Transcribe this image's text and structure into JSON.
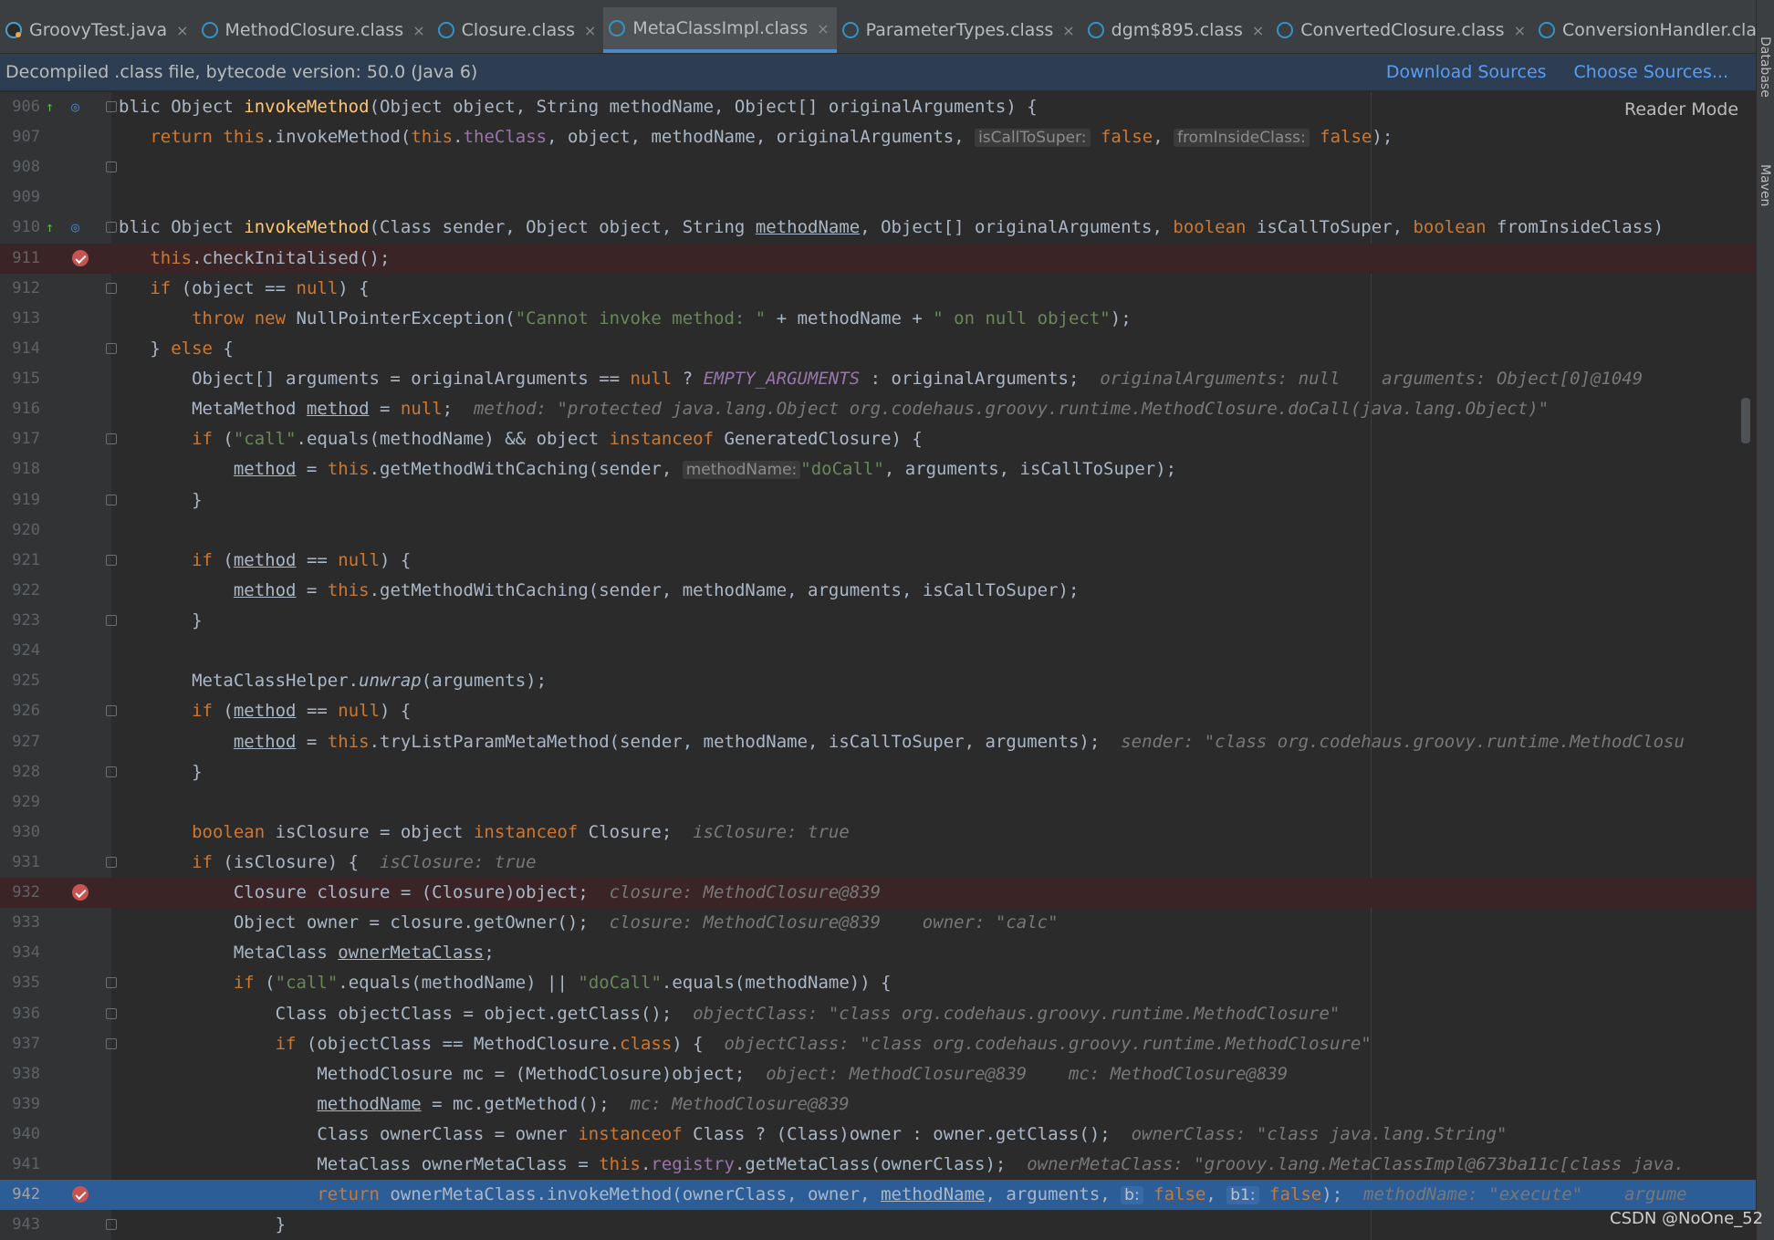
{
  "tabs": [
    {
      "label": "GroovyTest.java",
      "active": false
    },
    {
      "label": "MethodClosure.class",
      "active": false
    },
    {
      "label": "Closure.class",
      "active": false
    },
    {
      "label": "MetaClassImpl.class",
      "active": true
    },
    {
      "label": "ParameterTypes.class",
      "active": false
    },
    {
      "label": "dgm$895.class",
      "active": false
    },
    {
      "label": "ConvertedClosure.class",
      "active": false
    },
    {
      "label": "ConversionHandler.class",
      "active": false
    }
  ],
  "banner": {
    "message": "Decompiled .class file, bytecode version: 50.0 (Java 6)",
    "download": "Download Sources",
    "choose": "Choose Sources..."
  },
  "reader_mode": "Reader Mode",
  "side_tools": [
    "Database",
    "Maven"
  ],
  "watermark": "CSDN @NoOne_52",
  "colors": {
    "accent": "#4a88c7",
    "selected_line": "#2d5d96",
    "breakpoint": "#c75450"
  },
  "lines": [
    {
      "n": "906",
      "gi": [
        "override-icon",
        "quick-doc-icon"
      ],
      "fold": true,
      "segs": [
        [
          "",
          "blic Object "
        ],
        [
          "fn",
          "invokeMethod"
        ],
        [
          "",
          "(Object object, String methodName, Object[] originalArguments) {"
        ]
      ]
    },
    {
      "n": "907",
      "segs": [
        [
          "",
          "   "
        ],
        [
          "kw",
          "return this"
        ],
        [
          "",
          "."
        ],
        [
          "",
          "invokeMethod("
        ],
        [
          "kw",
          "this"
        ],
        [
          "",
          "."
        ],
        [
          "fld",
          "theClass"
        ],
        [
          "",
          ", object, methodName, originalArguments, "
        ],
        [
          "pl",
          "isCallToSuper:"
        ],
        [
          "",
          " "
        ],
        [
          "kw",
          "false"
        ],
        [
          "",
          ", "
        ],
        [
          "pl",
          "fromInsideClass:"
        ],
        [
          "",
          " "
        ],
        [
          "kw",
          "false"
        ],
        [
          "",
          ");"
        ]
      ]
    },
    {
      "n": "908",
      "fold": true,
      "segs": []
    },
    {
      "n": "909",
      "segs": []
    },
    {
      "n": "910",
      "gi": [
        "override-icon",
        "quick-doc-icon"
      ],
      "fold": true,
      "segs": [
        [
          "",
          "blic Object "
        ],
        [
          "fn",
          "invokeMethod"
        ],
        [
          "",
          "(Class sender, Object object, String "
        ],
        [
          "ul",
          "methodName"
        ],
        [
          "",
          ", Object[] originalArguments, "
        ],
        [
          "kw",
          "boolean"
        ],
        [
          "",
          " isCallToSuper, "
        ],
        [
          "kw",
          "boolean"
        ],
        [
          "",
          " fromInsideClass)"
        ]
      ]
    },
    {
      "n": "911",
      "bp": true,
      "segs": [
        [
          "",
          "   "
        ],
        [
          "kw",
          "this"
        ],
        [
          "",
          ".checkInitalised();"
        ]
      ]
    },
    {
      "n": "912",
      "fold": true,
      "segs": [
        [
          "",
          "   "
        ],
        [
          "kw",
          "if"
        ],
        [
          "",
          " (object == "
        ],
        [
          "kw",
          "null"
        ],
        [
          "",
          ") {"
        ]
      ]
    },
    {
      "n": "913",
      "segs": [
        [
          "",
          "       "
        ],
        [
          "kw",
          "throw new"
        ],
        [
          "",
          " NullPointerException("
        ],
        [
          "str",
          "\"Cannot invoke method: \""
        ],
        [
          "",
          " + methodName + "
        ],
        [
          "str",
          "\" on null object\""
        ],
        [
          "",
          ");"
        ]
      ]
    },
    {
      "n": "914",
      "fold": true,
      "segs": [
        [
          "",
          "   } "
        ],
        [
          "kw",
          "else"
        ],
        [
          "",
          " {"
        ]
      ]
    },
    {
      "n": "915",
      "segs": [
        [
          "",
          "       Object[] arguments = originalArguments == "
        ],
        [
          "kw",
          "null"
        ],
        [
          "",
          " ? "
        ],
        [
          "fld ita",
          "EMPTY_ARGUMENTS"
        ],
        [
          "",
          " : originalArguments;  "
        ],
        [
          "hint",
          "originalArguments: null    arguments: Object[0]@1049"
        ]
      ]
    },
    {
      "n": "916",
      "segs": [
        [
          "",
          "       MetaMethod "
        ],
        [
          "ul",
          "method"
        ],
        [
          "",
          " = "
        ],
        [
          "kw",
          "null"
        ],
        [
          "",
          ";  "
        ],
        [
          "hint",
          "method: \"protected java.lang.Object org.codehaus.groovy.runtime.MethodClosure.doCall(java.lang.Object)\""
        ]
      ]
    },
    {
      "n": "917",
      "fold": true,
      "segs": [
        [
          "",
          "       "
        ],
        [
          "kw",
          "if"
        ],
        [
          "",
          " ("
        ],
        [
          "str",
          "\"call\""
        ],
        [
          "",
          ".equals(methodName) && object "
        ],
        [
          "kw",
          "instanceof"
        ],
        [
          "",
          " GeneratedClosure) {"
        ]
      ]
    },
    {
      "n": "918",
      "segs": [
        [
          "",
          "           "
        ],
        [
          "ul",
          "method"
        ],
        [
          "",
          " = "
        ],
        [
          "kw",
          "this"
        ],
        [
          "",
          ".getMethodWithCaching(sender, "
        ],
        [
          "pl",
          "methodName:"
        ],
        [
          "",
          ""
        ],
        [
          "str",
          "\"doCall\""
        ],
        [
          "",
          ", arguments, isCallToSuper);"
        ]
      ]
    },
    {
      "n": "919",
      "fold": true,
      "segs": [
        [
          "",
          "       }"
        ]
      ]
    },
    {
      "n": "920",
      "segs": []
    },
    {
      "n": "921",
      "fold": true,
      "segs": [
        [
          "",
          "       "
        ],
        [
          "kw",
          "if"
        ],
        [
          "",
          " ("
        ],
        [
          "ul",
          "method"
        ],
        [
          "",
          " == "
        ],
        [
          "kw",
          "null"
        ],
        [
          "",
          ") {"
        ]
      ]
    },
    {
      "n": "922",
      "segs": [
        [
          "",
          "           "
        ],
        [
          "ul",
          "method"
        ],
        [
          "",
          " = "
        ],
        [
          "kw",
          "this"
        ],
        [
          "",
          ".getMethodWithCaching(sender, methodName, arguments, isCallToSuper);"
        ]
      ]
    },
    {
      "n": "923",
      "fold": true,
      "segs": [
        [
          "",
          "       }"
        ]
      ]
    },
    {
      "n": "924",
      "segs": []
    },
    {
      "n": "925",
      "segs": [
        [
          "",
          "       MetaClassHelper."
        ],
        [
          "ita",
          "unwrap"
        ],
        [
          "",
          "(arguments);"
        ]
      ]
    },
    {
      "n": "926",
      "fold": true,
      "segs": [
        [
          "",
          "       "
        ],
        [
          "kw",
          "if"
        ],
        [
          "",
          " ("
        ],
        [
          "ul",
          "method"
        ],
        [
          "",
          " == "
        ],
        [
          "kw",
          "null"
        ],
        [
          "",
          ") {"
        ]
      ]
    },
    {
      "n": "927",
      "segs": [
        [
          "",
          "           "
        ],
        [
          "ul",
          "method"
        ],
        [
          "",
          " = "
        ],
        [
          "kw",
          "this"
        ],
        [
          "",
          ".tryListParamMetaMethod(sender, methodName, isCallToSuper, arguments);  "
        ],
        [
          "hint",
          "sender: \"class org.codehaus.groovy.runtime.MethodClosu"
        ]
      ]
    },
    {
      "n": "928",
      "fold": true,
      "segs": [
        [
          "",
          "       }"
        ]
      ]
    },
    {
      "n": "929",
      "segs": []
    },
    {
      "n": "930",
      "segs": [
        [
          "",
          "       "
        ],
        [
          "kw",
          "boolean"
        ],
        [
          "",
          " isClosure = object "
        ],
        [
          "kw",
          "instanceof"
        ],
        [
          "",
          " Closure;  "
        ],
        [
          "hint",
          "isClosure: true"
        ]
      ]
    },
    {
      "n": "931",
      "fold": true,
      "segs": [
        [
          "",
          "       "
        ],
        [
          "kw",
          "if"
        ],
        [
          "",
          " (isClosure) {  "
        ],
        [
          "hint",
          "isClosure: true"
        ]
      ]
    },
    {
      "n": "932",
      "bp": true,
      "segs": [
        [
          "",
          "           Closure closure = (Closure)object;  "
        ],
        [
          "hint",
          "closure: MethodClosure@839"
        ]
      ]
    },
    {
      "n": "933",
      "segs": [
        [
          "",
          "           Object owner = closure.getOwner();  "
        ],
        [
          "hint",
          "closure: MethodClosure@839    owner: \"calc\""
        ]
      ]
    },
    {
      "n": "934",
      "segs": [
        [
          "",
          "           MetaClass "
        ],
        [
          "ul",
          "ownerMetaClass"
        ],
        [
          "",
          ";"
        ]
      ]
    },
    {
      "n": "935",
      "fold": true,
      "segs": [
        [
          "",
          "           "
        ],
        [
          "kw",
          "if"
        ],
        [
          "",
          " ("
        ],
        [
          "str",
          "\"call\""
        ],
        [
          "",
          ".equals(methodName) || "
        ],
        [
          "str",
          "\"doCall\""
        ],
        [
          "",
          ".equals(methodName)) {"
        ]
      ]
    },
    {
      "n": "936",
      "fold": true,
      "segs": [
        [
          "",
          "               Class objectClass = object.getClass();  "
        ],
        [
          "hint",
          "objectClass: \"class org.codehaus.groovy.runtime.MethodClosure\""
        ]
      ]
    },
    {
      "n": "937",
      "fold": true,
      "segs": [
        [
          "",
          "               "
        ],
        [
          "kw",
          "if"
        ],
        [
          "",
          " (objectClass == MethodClosure."
        ],
        [
          "kw",
          "class"
        ],
        [
          "",
          ") {  "
        ],
        [
          "hint",
          "objectClass: \"class org.codehaus.groovy.runtime.MethodClosure\""
        ]
      ]
    },
    {
      "n": "938",
      "segs": [
        [
          "",
          "                   MethodClosure mc = (MethodClosure)object;  "
        ],
        [
          "hint",
          "object: MethodClosure@839    mc: MethodClosure@839"
        ]
      ]
    },
    {
      "n": "939",
      "segs": [
        [
          "",
          "                   "
        ],
        [
          "ul",
          "methodName"
        ],
        [
          "",
          " = mc.getMethod();  "
        ],
        [
          "hint",
          "mc: MethodClosure@839"
        ]
      ]
    },
    {
      "n": "940",
      "segs": [
        [
          "",
          "                   Class ownerClass = owner "
        ],
        [
          "kw",
          "instanceof"
        ],
        [
          "",
          " Class ? (Class)owner : owner.getClass();  "
        ],
        [
          "hint",
          "ownerClass: \"class java.lang.String\""
        ]
      ]
    },
    {
      "n": "941",
      "segs": [
        [
          "",
          "                   MetaClass ownerMetaClass = "
        ],
        [
          "kw",
          "this"
        ],
        [
          "",
          "."
        ],
        [
          "fld",
          "registry"
        ],
        [
          "",
          ".getMetaClass(ownerClass);  "
        ],
        [
          "hint",
          "ownerMetaClass: \"groovy.lang.MetaClassImpl@673ba11c[class java."
        ]
      ]
    },
    {
      "n": "942",
      "bp": true,
      "sel": true,
      "segs": [
        [
          "",
          "                   "
        ],
        [
          "kw",
          "return"
        ],
        [
          "",
          " ownerMetaClass.invokeMethod(ownerClass, owner, "
        ],
        [
          "ul",
          "methodName"
        ],
        [
          "",
          ", arguments, "
        ],
        [
          "pl",
          "b:"
        ],
        [
          "",
          " "
        ],
        [
          "kw",
          "false"
        ],
        [
          "",
          ", "
        ],
        [
          "pl",
          "b1:"
        ],
        [
          "",
          " "
        ],
        [
          "kw",
          "false"
        ],
        [
          "",
          ");  "
        ],
        [
          "hint",
          "methodName: \"execute\"    argume"
        ]
      ]
    },
    {
      "n": "943",
      "fold": true,
      "segs": [
        [
          "",
          "               }"
        ]
      ]
    }
  ]
}
